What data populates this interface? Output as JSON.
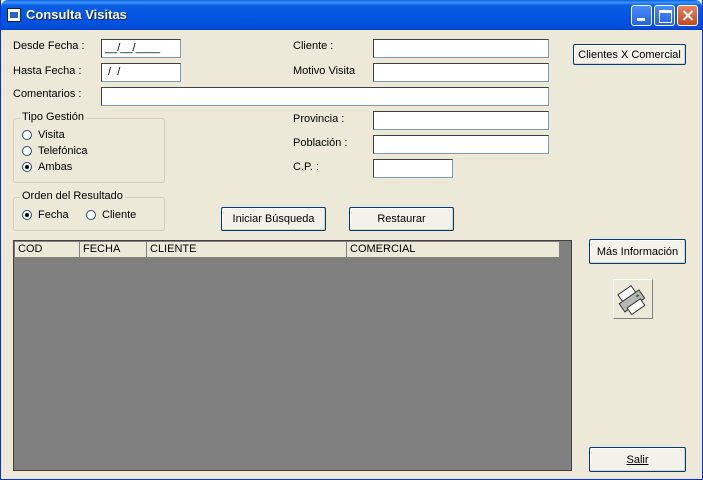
{
  "window": {
    "title": "Consulta Visitas"
  },
  "form": {
    "desde_fecha": {
      "label": "Desde Fecha :",
      "value": "__/__/____"
    },
    "hasta_fecha": {
      "label": "Hasta Fecha :",
      "value": " /  /"
    },
    "comentarios": {
      "label": "Comentarios :",
      "value": ""
    },
    "cliente": {
      "label": "Cliente :",
      "value": ""
    },
    "motivo_visita": {
      "label": "Motivo Visita",
      "value": ""
    },
    "provincia": {
      "label": "Provincia :",
      "value": ""
    },
    "poblacion": {
      "label": "Población :",
      "value": ""
    },
    "cp": {
      "label": "C.P. :",
      "value": ""
    }
  },
  "tipo_gestion": {
    "title": "Tipo Gestión",
    "options": [
      {
        "label": "Visita",
        "selected": false
      },
      {
        "label": "Telefónica",
        "selected": false
      },
      {
        "label": "Ambas",
        "selected": true
      }
    ]
  },
  "orden_resultado": {
    "title": "Orden del Resultado",
    "options": [
      {
        "label": "Fecha",
        "selected": true
      },
      {
        "label": "Cliente",
        "selected": false
      }
    ]
  },
  "buttons": {
    "clientes_comercial": "Clientes X Comercial",
    "iniciar_busqueda": "Iniciar Búsqueda",
    "restaurar": "Restaurar",
    "mas_informacion": "Más Información",
    "salir": "Salir"
  },
  "grid": {
    "columns": [
      "COD",
      "FECHA",
      "CLIENTE",
      "COMERCIAL"
    ]
  },
  "icons": {
    "title": "app-icon",
    "print": "printer-icon"
  }
}
